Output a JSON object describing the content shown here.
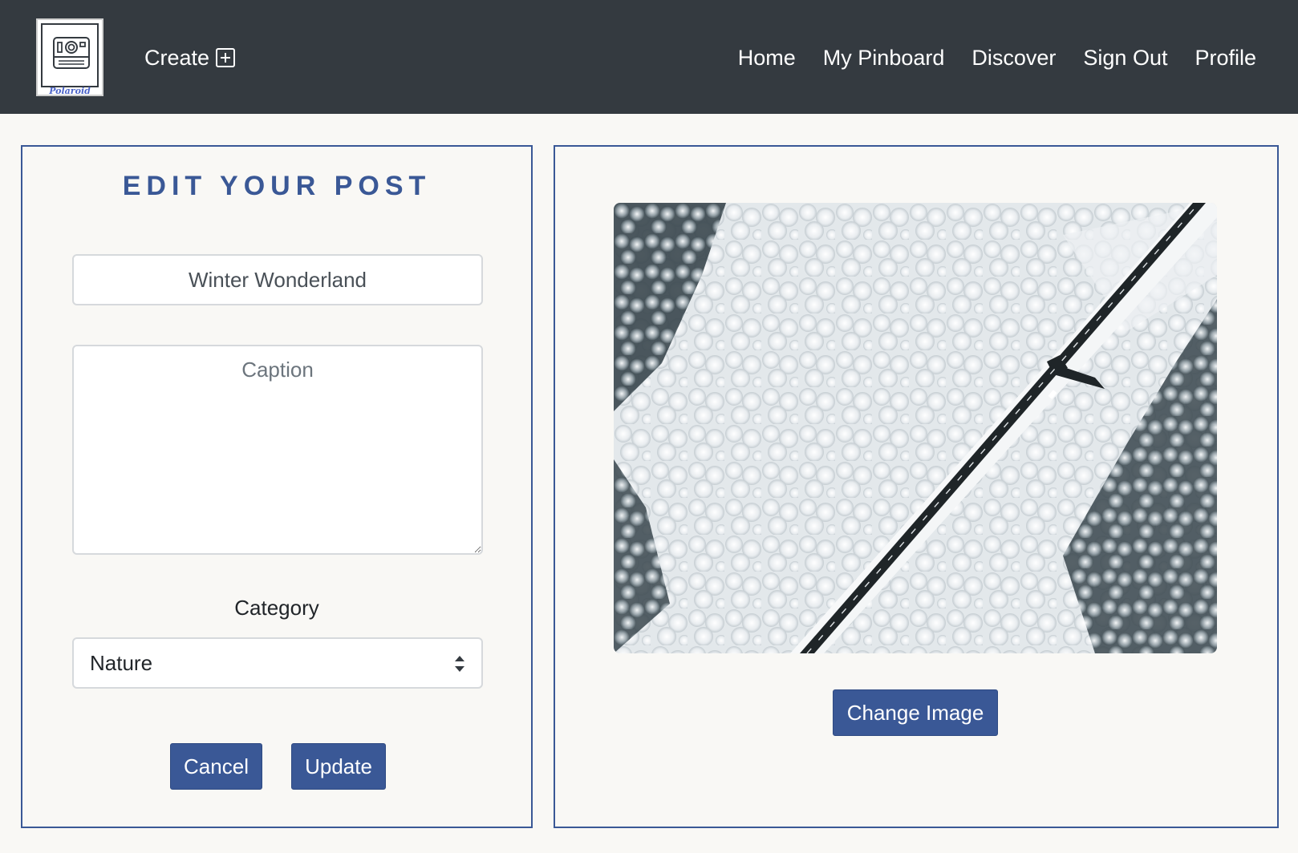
{
  "navbar": {
    "logo_text": "Polaroid",
    "create_label": "Create",
    "links": [
      "Home",
      "My Pinboard",
      "Discover",
      "Sign Out",
      "Profile"
    ]
  },
  "edit_form": {
    "title": "EDIT YOUR POST",
    "title_value": "Winter Wonderland",
    "caption_placeholder": "Caption",
    "category_label": "Category",
    "category_value": "Nature",
    "cancel_label": "Cancel",
    "update_label": "Update"
  },
  "image_panel": {
    "change_image_label": "Change Image"
  },
  "colors": {
    "navbar_bg": "#343a40",
    "accent": "#3a5896",
    "page_bg": "#f9f8f5"
  }
}
